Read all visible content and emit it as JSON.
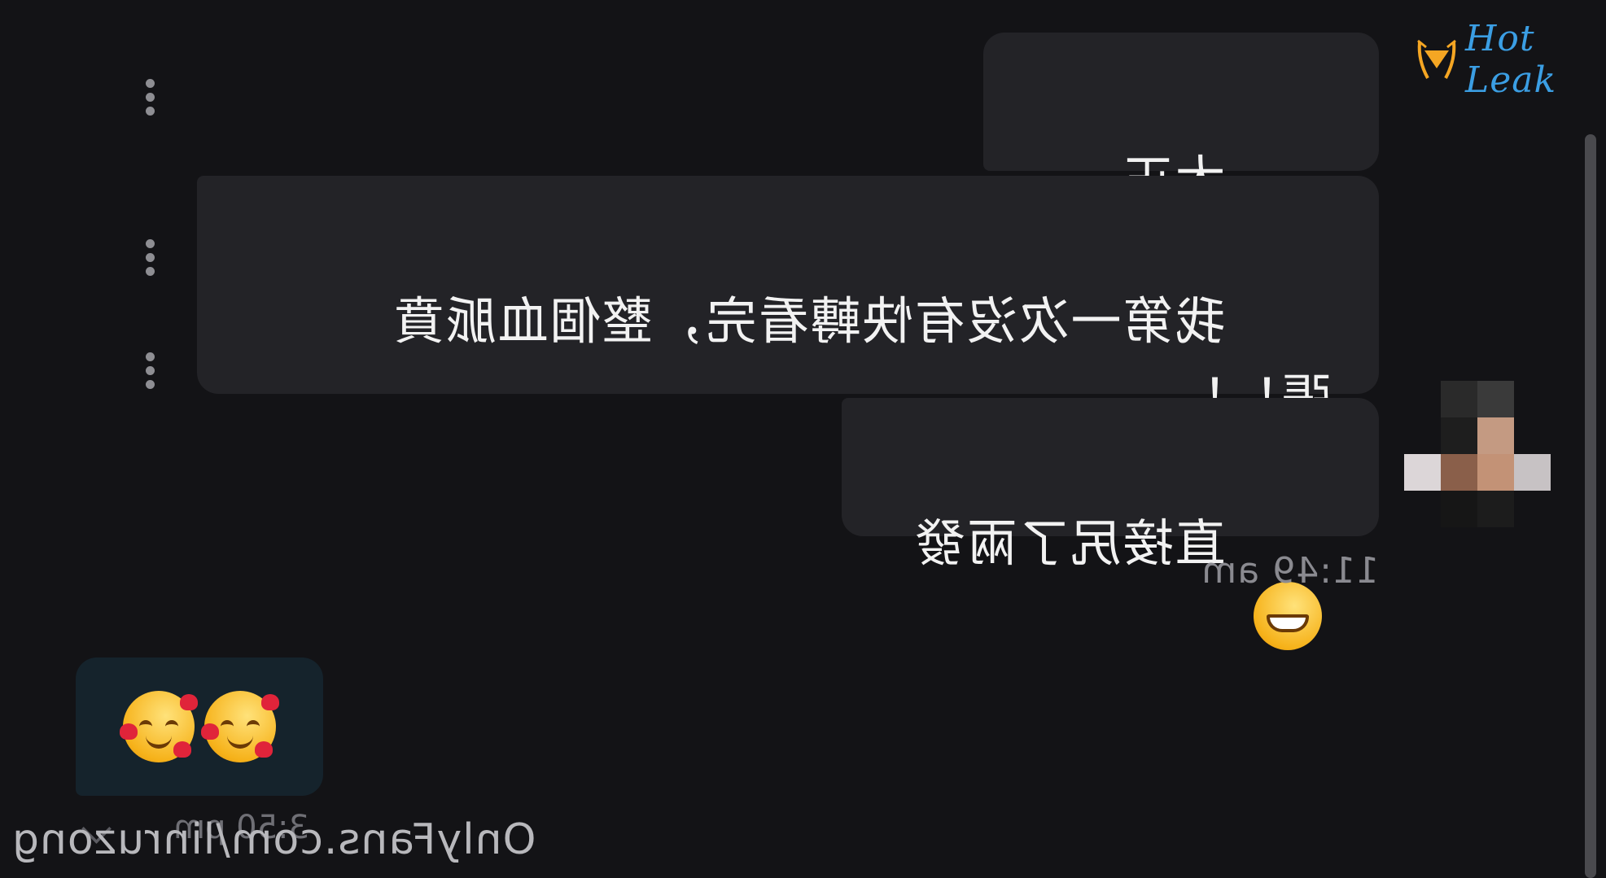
{
  "messages": [
    {
      "text": "大正了！！"
    },
    {
      "text": "我第一次沒有快轉看完，整個血脈賁\n張！！"
    },
    {
      "text": "直接尻了兩發",
      "emoji": "grinning-face"
    }
  ],
  "outgoing_time": "11:49 am",
  "incoming": {
    "emoji": [
      "smiling-face-with-hearts",
      "smiling-face-with-hearts"
    ],
    "time": "3:50 pm"
  },
  "watermark": "OnlyFans.com/linruzong",
  "logo": {
    "text": "Hot Leak",
    "color": "#3b9ee3"
  },
  "colors": {
    "background": "#131316",
    "bubble": "#232327",
    "incoming_bubble": "#15232c",
    "text": "#f2f2f2",
    "muted": "#8a8a90"
  }
}
